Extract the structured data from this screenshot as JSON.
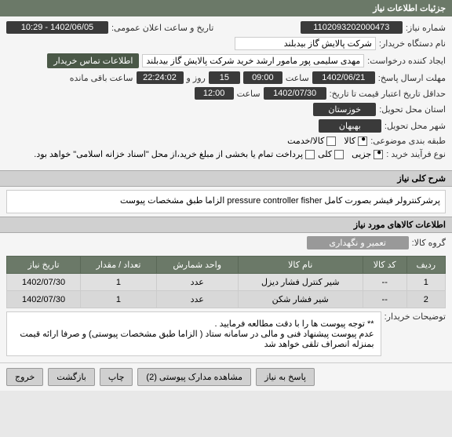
{
  "header": {
    "title": "جزئیات اطلاعات نیاز"
  },
  "form": {
    "need_number_label": "شماره نیاز:",
    "need_number": "1102093202000473",
    "public_date_label": "تاریخ و ساعت اعلان عمومی:",
    "public_date": "1402/06/05 - 10:29",
    "buyer_org_label": "نام دستگاه خریدار:",
    "buyer_org": "شرکت پالایش گاز بیدبلند",
    "requester_label": "ایجاد کننده درخواست:",
    "requester": "مهدی سلیمی پور مامور ارشد خرید شرکت پالایش گاز بیدبلند",
    "contact_info_btn": "اطلاعات تماس خریدار",
    "deadline_label": "مهلت ارسال پاسخ:",
    "deadline_date": "1402/06/21",
    "time_label": "ساعت",
    "deadline_time": "09:00",
    "days": "15",
    "days_label": "روز و",
    "countdown": "22:24:02",
    "remaining_label": "ساعت باقی مانده",
    "validity_label": "حداقل تاریخ اعتبار قیمت تا تاریخ:",
    "validity_date": "1402/07/30",
    "validity_time": "12:00",
    "province_label": "استان محل تحویل:",
    "province": "خوزستان",
    "city_label": "شهر محل تحویل:",
    "city": "بهبهان",
    "classification_label": "طبقه بندی موضوعی:",
    "class_kala": "کالا",
    "class_khadamat": "کالا/خدمت",
    "buy_type_label": "نوع فرآیند خرید :",
    "buy_jozi": "جزیی",
    "buy_koli": "کلی",
    "payment_note": "پرداخت تمام یا بخشی از مبلغ خرید،از محل \"اسناد خزانه اسلامی\" خواهد بود."
  },
  "sections": {
    "general_desc_title": "شرح کلی نیاز",
    "general_desc": "پرشرکنترولر فیشر بصورت کامل pressure controller fisher الزاما طبق مشخصات پیوست",
    "items_title": "اطلاعات کالاهای مورد نیاز",
    "group_label": "گروه کالا:",
    "group_value": "تعمیر و نگهداری",
    "buyer_notes_label": "توضیحات خریدار:",
    "buyer_notes_line1": "** توجه پیوست ها  را با دقت مطالعه فرمایید .",
    "buyer_notes_line2": "عدم پیوست پیشنهاد فنی و مالی در سامانه ستاد ( الزاما طبق مشخصات پیوستی)  و صرفا ارائه قیمت بمنزله انصراف تلقی خواهد شد"
  },
  "table": {
    "headers": [
      "ردیف",
      "کد کالا",
      "نام کالا",
      "واحد شمارش",
      "تعداد / مقدار",
      "تاریخ نیاز"
    ],
    "rows": [
      {
        "idx": "1",
        "code": "--",
        "name": "شیر کنترل فشار دیزل",
        "unit": "عدد",
        "qty": "1",
        "date": "1402/07/30"
      },
      {
        "idx": "2",
        "code": "--",
        "name": "شیر فشار شکن",
        "unit": "عدد",
        "qty": "1",
        "date": "1402/07/30"
      }
    ]
  },
  "buttons": {
    "reply": "پاسخ به نیاز",
    "attachments": "مشاهده مدارک پیوستی (2)",
    "print": "چاپ",
    "back": "بازگشت",
    "exit": "خروج"
  }
}
